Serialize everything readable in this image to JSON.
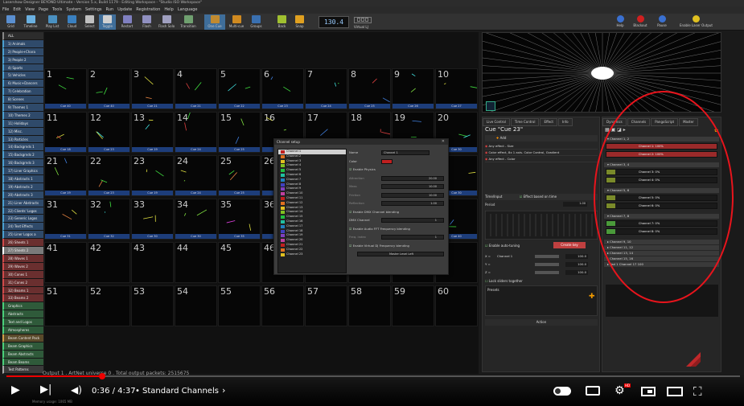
{
  "window": {
    "title": "Lasershow Designer BEYOND Ultimate - Version 5.x, Build 1179 - Editing Workspace - \"Studio ISO Workspace\""
  },
  "menu": [
    "File",
    "Edit",
    "View",
    "Page",
    "Tools",
    "System",
    "Settings",
    "Run",
    "Update",
    "Registration",
    "Help",
    "Language"
  ],
  "toolbar": {
    "buttons": [
      {
        "label": "Grid",
        "color": "#5a8fd0"
      },
      {
        "label": "Timeline",
        "color": "#6ab0e0"
      },
      {
        "label": "Play List",
        "color": "#4a90c0"
      },
      {
        "label": "Cloud",
        "color": "#3a80c0"
      },
      {
        "label": "Select",
        "color": "#c0c0c0"
      },
      {
        "label": "Toggle",
        "color": "#d0d0d0"
      },
      {
        "label": "Restart",
        "color": "#8080c0"
      },
      {
        "label": "Flash",
        "color": "#9090c0"
      },
      {
        "label": "Flash Solo",
        "color": "#a0a0c0"
      },
      {
        "label": "Transition",
        "color": "#70a070"
      },
      {
        "label": "One Cue",
        "color": "#c08a30"
      },
      {
        "label": "Multi-cue",
        "color": "#d08a20"
      },
      {
        "label": "Groups",
        "color": "#3a70b0"
      },
      {
        "label": "Back",
        "color": "#a0c030"
      },
      {
        "label": "Snap",
        "color": "#e0a020"
      }
    ],
    "bpm": "130.4",
    "virtual_lj": "Virtual LJ",
    "right_buttons": [
      {
        "label": "Help"
      },
      {
        "label": "Blackout"
      },
      {
        "label": "Pause"
      },
      {
        "label": "Enable Laser Output"
      }
    ]
  },
  "sidebar": {
    "items": [
      {
        "label": "ALL",
        "color": "#2c2c2c",
        "accent": "#888"
      },
      {
        "label": "1) Animals",
        "color": "#2f4a6a",
        "accent": "#4aa0d0"
      },
      {
        "label": "2) People+Chara",
        "color": "#2f4a6a",
        "accent": "#4aa0d0"
      },
      {
        "label": "3) People 2",
        "color": "#2f4a6a",
        "accent": "#4aa0d0"
      },
      {
        "label": "4) Sports",
        "color": "#2f4a6a",
        "accent": "#4aa0d0"
      },
      {
        "label": "5) Vehicles",
        "color": "#2f4a6a",
        "accent": "#4aa0d0"
      },
      {
        "label": "6) Music+Dancers",
        "color": "#2f4a6a",
        "accent": "#4aa0d0"
      },
      {
        "label": "7) Celebration",
        "color": "#2f4a6a",
        "accent": "#4aa0d0"
      },
      {
        "label": "8) Scenes",
        "color": "#2f4a6a",
        "accent": "#4aa0d0"
      },
      {
        "label": "9) Themes 1",
        "color": "#2f4a6a",
        "accent": "#4aa0d0"
      },
      {
        "label": "10) Themes 2",
        "color": "#2f4a6a",
        "accent": "#4aa0d0"
      },
      {
        "label": "11) Holidays",
        "color": "#2f4a6a",
        "accent": "#4aa0d0"
      },
      {
        "label": "12) Misc.",
        "color": "#2f4a6a",
        "accent": "#4aa0d0"
      },
      {
        "label": "13) Particles",
        "color": "#2f4a6a",
        "accent": "#4aa0d0"
      },
      {
        "label": "14) Backgrnds 1",
        "color": "#2f4a6a",
        "accent": "#4aa0d0"
      },
      {
        "label": "15) Backgrnds 2",
        "color": "#2f4a6a",
        "accent": "#4aa0d0"
      },
      {
        "label": "16) Backgrnds 3",
        "color": "#2f4a6a",
        "accent": "#4aa0d0"
      },
      {
        "label": "17) Liner Graphics",
        "color": "#2f4a6a",
        "accent": "#4aa0d0"
      },
      {
        "label": "18) Abstracts 1",
        "color": "#2f4a6a",
        "accent": "#4aa0d0"
      },
      {
        "label": "19) Abstracts 2",
        "color": "#2f4a6a",
        "accent": "#4aa0d0"
      },
      {
        "label": "20) Abstracts 3",
        "color": "#2f4a6a",
        "accent": "#4aa0d0"
      },
      {
        "label": "21) Liner Abstracts",
        "color": "#2f4a6a",
        "accent": "#4aa0d0"
      },
      {
        "label": "22) Clients' Logos",
        "color": "#2f4a6a",
        "accent": "#4aa0d0"
      },
      {
        "label": "23) Generic Logos",
        "color": "#2f4a6a",
        "accent": "#4aa0d0"
      },
      {
        "label": "24) Text Effects",
        "color": "#2f4a6a",
        "accent": "#4aa0d0"
      },
      {
        "label": "25) Liner Logos a",
        "color": "#2f4a6a",
        "accent": "#4aa0d0"
      },
      {
        "label": "26) Sheets 1",
        "color": "#6a2f2f",
        "accent": "#d04a4a"
      },
      {
        "label": "27) Sheets 2",
        "color": "#7a7a7a",
        "accent": "#fff"
      },
      {
        "label": "28) Waves 1",
        "color": "#6a2f2f",
        "accent": "#d04a4a"
      },
      {
        "label": "29) Waves 2",
        "color": "#6a2f2f",
        "accent": "#d04a4a"
      },
      {
        "label": "30) Cones 1",
        "color": "#6a2f2f",
        "accent": "#d04a4a"
      },
      {
        "label": "31) Cones 2",
        "color": "#6a2f2f",
        "accent": "#d04a4a"
      },
      {
        "label": "32) Beams 1",
        "color": "#6a2f2f",
        "accent": "#d04a4a"
      },
      {
        "label": "33) Beams 2",
        "color": "#6a2f2f",
        "accent": "#d04a4a"
      },
      {
        "label": "Graphics",
        "color": "#2f5a3a",
        "accent": "#4ad07a"
      },
      {
        "label": "Abstracts",
        "color": "#2f5a3a",
        "accent": "#4ad07a"
      },
      {
        "label": "Text and Logos",
        "color": "#2f5a3a",
        "accent": "#4ad07a"
      },
      {
        "label": "Atmospheres",
        "color": "#2f5a3a",
        "accent": "#4ad07a"
      },
      {
        "label": "Beam Content Pack",
        "color": "#5a4a2a",
        "accent": "#d0a04a"
      },
      {
        "label": "Beam Graphics",
        "color": "#2f5a3a",
        "accent": "#4ad07a"
      },
      {
        "label": "Beam Abstracts",
        "color": "#2f5a3a",
        "accent": "#4ad07a"
      },
      {
        "label": "Beam Beams",
        "color": "#2f5a3a",
        "accent": "#4ad07a"
      },
      {
        "label": "Test Patterns",
        "color": "#3a3a3a",
        "accent": "#aaa"
      }
    ]
  },
  "grid": {
    "rows": [
      {
        "nums": [
          "1",
          "2",
          "3",
          "4",
          "5",
          "6",
          "7",
          "8",
          "9",
          "10"
        ],
        "labels": [
          "Cue 40",
          "Cue 40",
          "Cue 21",
          "Cue 21",
          "Cue 22",
          "Cue 23",
          "Cue 24",
          "Cue 25",
          "Cue 26",
          "Cue 27"
        ]
      },
      {
        "nums": [
          "11",
          "12",
          "13",
          "14",
          "15",
          "16",
          "17",
          "18",
          "19",
          "20"
        ],
        "labels": [
          "Cue 18",
          "Cue 23",
          "Cue 19",
          "Cue 24",
          "Cue 25",
          "Cue 26",
          "Cue 29",
          "Cue 28",
          "Cue 29",
          "Cue 30"
        ]
      },
      {
        "nums": [
          "21",
          "22",
          "23",
          "24",
          "25",
          "26",
          "27",
          "28",
          "29",
          "30"
        ],
        "labels": [
          "Cue 19",
          "Cue 23",
          "Cue 19",
          "Cue 24",
          "Cue 25",
          "Cue 26",
          "Cue 27",
          "Cue 28",
          "Cue 29",
          "Cue 30"
        ]
      },
      {
        "nums": [
          "31",
          "32",
          "33",
          "34",
          "35",
          "36",
          "37",
          "38",
          "39",
          "40"
        ],
        "labels": [
          "Cue 31",
          "Cue 32",
          "Cue 30",
          "Cue 30",
          "Cue 35",
          "Cue 31",
          "Cue 37",
          "Cue 38",
          "Cue 39",
          "Cue 40"
        ]
      },
      {
        "nums": [
          "41",
          "42",
          "43",
          "44",
          "45",
          "46",
          "47",
          "48",
          "49",
          "50"
        ],
        "labels": [
          "",
          "",
          "",
          "",
          "",
          "",
          "",
          "",
          "",
          ""
        ]
      },
      {
        "nums": [
          "51",
          "52",
          "53",
          "54",
          "55",
          "56",
          "57",
          "58",
          "59",
          "60"
        ],
        "labels": [
          "",
          "",
          "",
          "",
          "",
          "",
          "",
          "",
          "",
          ""
        ]
      }
    ]
  },
  "dialog": {
    "title": "Channel setup",
    "channels": [
      "Channel 1",
      "Channel 2",
      "Channel 3",
      "Channel 4",
      "Channel 5",
      "Channel 6",
      "Channel 7",
      "Channel 8",
      "Channel 9",
      "Channel 10",
      "Channel 11",
      "Channel 12",
      "Channel 13",
      "Channel 14",
      "Channel 15",
      "Channel 16",
      "Channel 17",
      "Channel 18",
      "Channel 19",
      "Channel 20",
      "Channel 21",
      "Channel 22",
      "Channel 23"
    ],
    "name_label": "Name",
    "name_value": "Channel 1",
    "color_label": "Color",
    "enable_physics": "Enable Physics",
    "attraction": "Attraction",
    "attraction_v": "20.00",
    "mass": "Mass",
    "mass_v": "10.00",
    "friction": "Friction",
    "friction_v": "10.00",
    "reflection": "Reflection",
    "reflection_v": "1.00",
    "dmx_blend": "Enable DMX Channel blending",
    "dmx_channel": "DMX Channel",
    "dmx_v": "1",
    "fft_blend": "Enable Audio FFT Frequency blending",
    "freq_index": "Freq. index",
    "freq_v": "1",
    "vdj_blend": "Enable Virtual DJ Frequency blending",
    "master": "Master Level Left"
  },
  "right": {
    "tabs_left": [
      "Live Control",
      "Time Control",
      "Effect",
      "Info"
    ],
    "tabs_right": [
      "Dynamics",
      "Channels",
      "PangoScript",
      "Master"
    ],
    "cue_title": "Cue \"Cue 23\"",
    "add": "Add",
    "effects": [
      "Any effect - Size",
      "Color effect, 8x 1 axis. Color Control, Gradient",
      "Any effect - Color"
    ],
    "time_input": "Time/Input",
    "effect_based": "Effect based on time",
    "period": "Period",
    "period_v": "1.00",
    "auto_tuning": "Enable auto-tuning",
    "create_key": "Create key",
    "xyz": [
      {
        "axis": "X =",
        "ch": "Channel 1",
        "v": "100.0"
      },
      {
        "axis": "Y =",
        "ch": "",
        "v": "100.0"
      },
      {
        "axis": "Z =",
        "ch": "",
        "v": "100.0"
      }
    ],
    "lock_sliders": "Lock sliders together",
    "presets": "Presets",
    "action": "Action",
    "groups": [
      {
        "title": "Channel 1, 2",
        "rows": [
          {
            "t": "Channel 1: 100%",
            "v": 1.0,
            "c": "#9a2a2a"
          },
          {
            "t": "Channel 2: 100%",
            "v": 1.0,
            "c": "#9a2a2a"
          }
        ]
      },
      {
        "title": "Channel 3, 4",
        "rows": [
          {
            "t": "Channel 3: 0%",
            "v": 0.0,
            "c": "#7a8a2a"
          },
          {
            "t": "Channel 4: 0%",
            "v": 0.0,
            "c": "#7a8a2a"
          }
        ]
      },
      {
        "title": "Channel 5, 6",
        "rows": [
          {
            "t": "Channel 5: 0%",
            "v": 0.0,
            "c": "#7a8a2a"
          },
          {
            "t": "Channel 6: 0%",
            "v": 0.0,
            "c": "#7a8a2a"
          }
        ]
      },
      {
        "title": "Channel 7, 8",
        "rows": [
          {
            "t": "Channel 7: 0%",
            "v": 0.0,
            "c": "#4a9a3a"
          },
          {
            "t": "Channel 8: 0%",
            "v": 0.0,
            "c": "#4a9a3a"
          }
        ]
      }
    ],
    "collapsed": [
      "Channel 9, 10",
      "Channel 11, 12",
      "Channel 13, 14",
      "Channel 15, 16",
      "Pad 1 Channel 17 100"
    ]
  },
  "status": {
    "output": "Output 1 . ArtNet universe 0 . Total output packets: 2515675",
    "memory": "Memory usage: 1065 MB"
  },
  "player": {
    "time": "0:36 / 4:37",
    "chapter": "Standard Channels",
    "progress": 0.13
  }
}
